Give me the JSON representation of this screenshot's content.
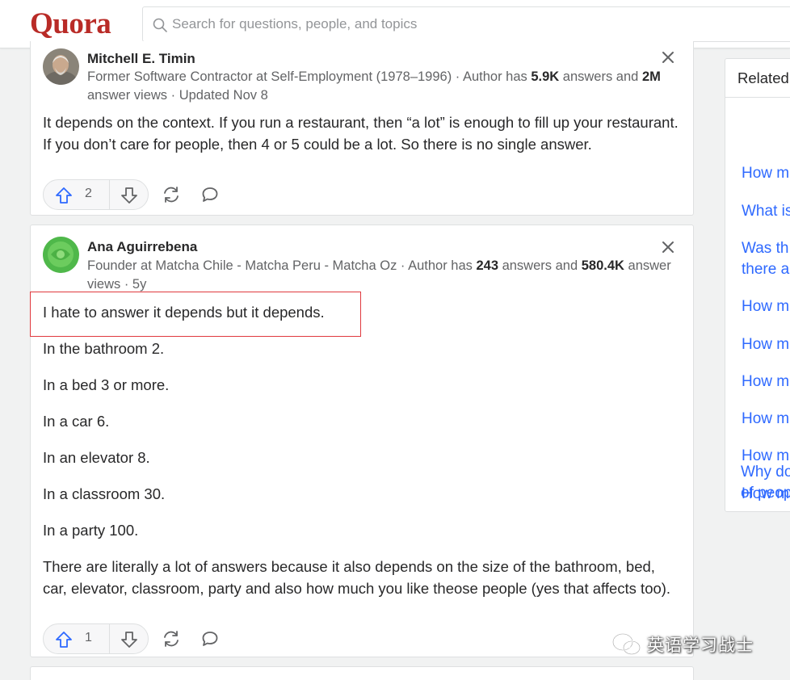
{
  "header": {
    "logo": "Quora",
    "search_placeholder": "Search for questions, people, and topics"
  },
  "answers": [
    {
      "author": "Mitchell E. Timin",
      "credential_prefix": "Former Software Contractor at Self-Employment (1978–1996) · Author has ",
      "answers_count": "5.9K",
      "credential_mid": " answers and ",
      "views_count": "2M",
      "credential_suffix": " answer views · Updated Nov 8",
      "paragraphs": [
        "It depends on the context. If you run a restaurant, then “a lot” is enough to fill up your restaurant. If you don’t care for people, then 4 or 5 could be a lot. So there is no single answer."
      ],
      "upvotes": "2"
    },
    {
      "author": "Ana Aguirrebena",
      "credential_prefix": "Founder at Matcha Chile - Matcha Peru - Matcha Oz · Author has ",
      "answers_count": "243",
      "credential_mid": " answers and ",
      "views_count": "580.4K",
      "credential_suffix": " answer views · 5y",
      "paragraphs": [
        "I hate to answer it depends but it depends.",
        "In the bathroom 2.",
        "In a bed 3 or more.",
        "In a car 6.",
        "In an elevator 8.",
        "In a classroom 30.",
        "In a party 100.",
        "There are literally a lot of answers because it also depends on the size of the bathroom, bed, car, elevator, classroom, party and also how much you like theose people (yes that affects too)."
      ],
      "upvotes": "1"
    }
  ],
  "sidebar": {
    "title": "Related",
    "links": [
      [
        "How m"
      ],
      [
        "What is"
      ],
      [
        "Was th",
        "there a"
      ],
      [
        "How m"
      ],
      [
        "How m"
      ],
      [
        "How m"
      ],
      [
        "How m"
      ],
      [
        "How m"
      ],
      [
        "How m"
      ],
      [
        "Why do",
        "of peop"
      ]
    ]
  },
  "watermark": {
    "text": "英语学习战士"
  },
  "colors": {
    "brand": "#b92b27",
    "link": "#2e69ff",
    "upvote": "#2e69ff",
    "highlight_border": "#e0393e"
  }
}
